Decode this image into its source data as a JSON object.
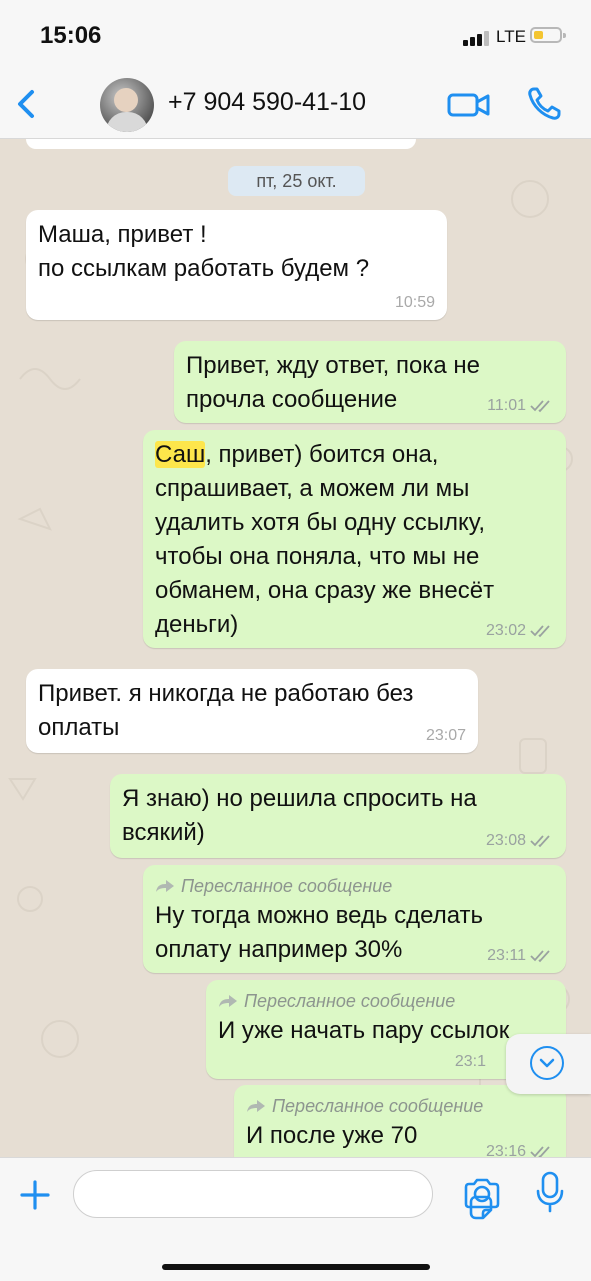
{
  "status": {
    "time": "15:06",
    "network": "LTE"
  },
  "header": {
    "contact": "+7 904 590-41-10"
  },
  "chat": {
    "date": "пт, 25 окт.",
    "messages": [
      {
        "dir": "in",
        "text": "Маша, привет !\nпо ссылкам работать будем ?",
        "time": "10:59"
      },
      {
        "dir": "out",
        "text": "Привет, жду ответ, пока не\nпрочла сообщение",
        "time": "11:01"
      },
      {
        "dir": "out",
        "highlight": "Саш",
        "text": ", привет) боится она,\nспрашивает, а можем ли мы\nудалить хотя бы одну ссылку,\nчтобы она поняла, что мы не\nобманем, она сразу же внесёт\nденьги)",
        "time": "23:02"
      },
      {
        "dir": "in",
        "text": "Привет. я никогда не работаю без\nоплаты",
        "time": "23:07"
      },
      {
        "dir": "out",
        "text": "Я знаю) но решила спросить на\nвсякий)",
        "time": "23:08"
      },
      {
        "dir": "out",
        "forwarded": "Пересланное сообщение",
        "text": "Ну тогда можно ведь сделать\nоплату например 30%",
        "time": "23:11"
      },
      {
        "dir": "out",
        "forwarded": "Пересланное сообщение",
        "text": "И уже начать пару ссылок",
        "time": "23:1"
      },
      {
        "dir": "out",
        "forwarded": "Пересланное сообщение",
        "text": "И после уже 70",
        "time": "23:16"
      }
    ]
  },
  "composer": {
    "placeholder": ""
  },
  "colors": {
    "accent": "#1f8ff0",
    "outgoing": "#dcf8c6",
    "incoming": "#ffffff",
    "highlight": "#fde64b"
  }
}
